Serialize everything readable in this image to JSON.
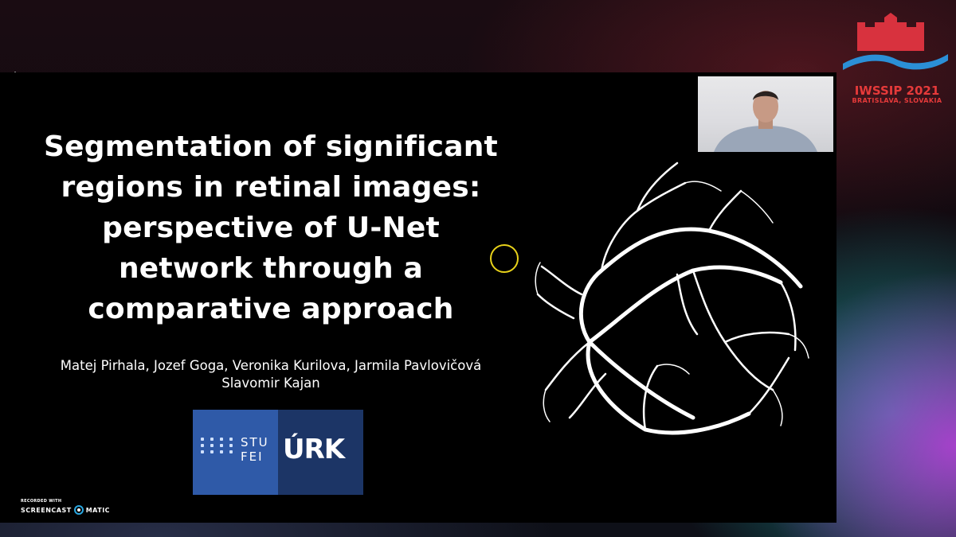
{
  "slide": {
    "title_lines": [
      "Segmentation of significant",
      "regions in retinal images:",
      "perspective of U-Net",
      "network through a",
      "comparative approach"
    ],
    "authors_line1": "Matej Pirhala, Jozef Goga, Veronika Kurilova, Jarmila Pavlovičová",
    "authors_line2": "Slavomir Kajan",
    "logo_stu_text_line1": "STU",
    "logo_stu_text_line2": "FEI",
    "logo_urk_text": "ÚRK"
  },
  "conference": {
    "title": "IWSSIP 2021",
    "subtitle": "BRATISLAVA, SLOVAKIA",
    "accent_red": "#e63a3a",
    "accent_blue": "#2b8fd6"
  },
  "watermark": {
    "small": "RECORDED WITH",
    "left": "SCREENCAST",
    "right": "MATIC"
  },
  "colors": {
    "slide_bg": "#000000",
    "stu_blue": "#2f5aa8",
    "urk_navy": "#1c3566",
    "cursor_ring": "#e8d21a"
  },
  "icons": [
    "cursor-ring-icon",
    "screencast-record-icon",
    "bratislava-castle-logo-icon",
    "retina-vessel-image"
  ]
}
